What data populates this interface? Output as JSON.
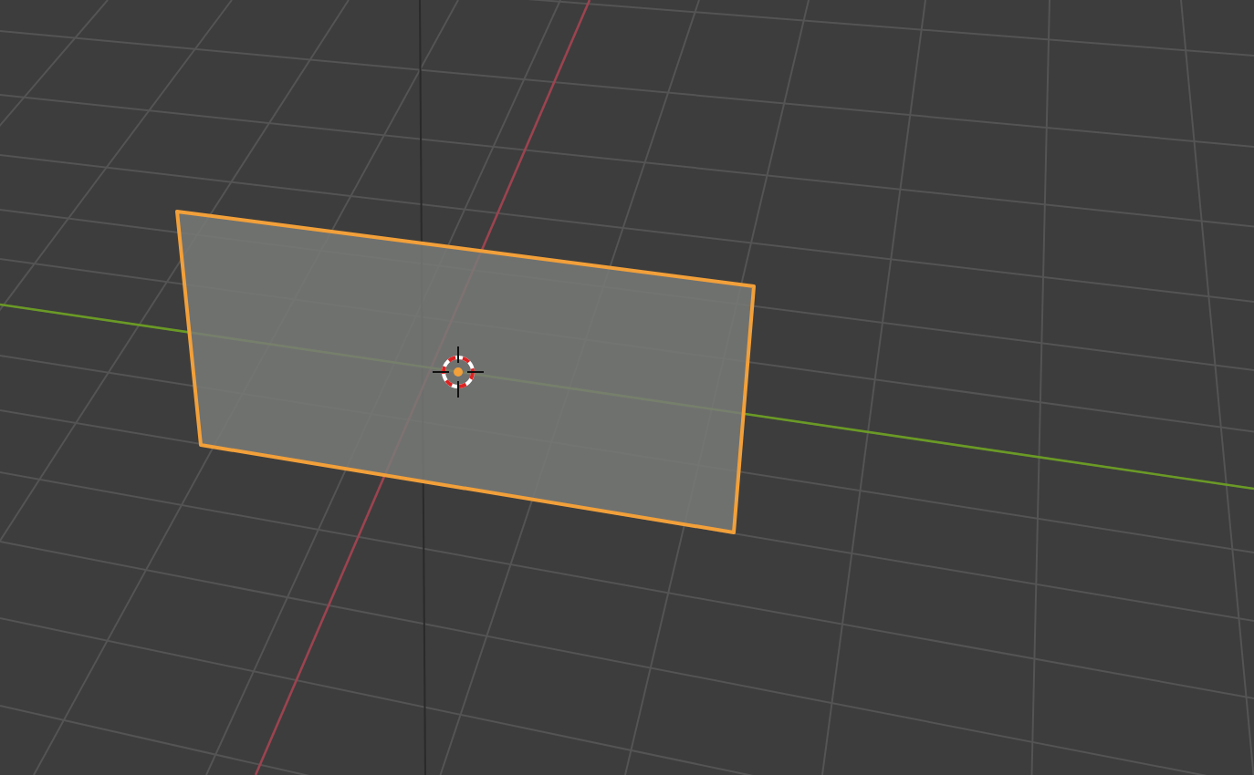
{
  "viewport": {
    "plane": {
      "selected": true
    }
  }
}
